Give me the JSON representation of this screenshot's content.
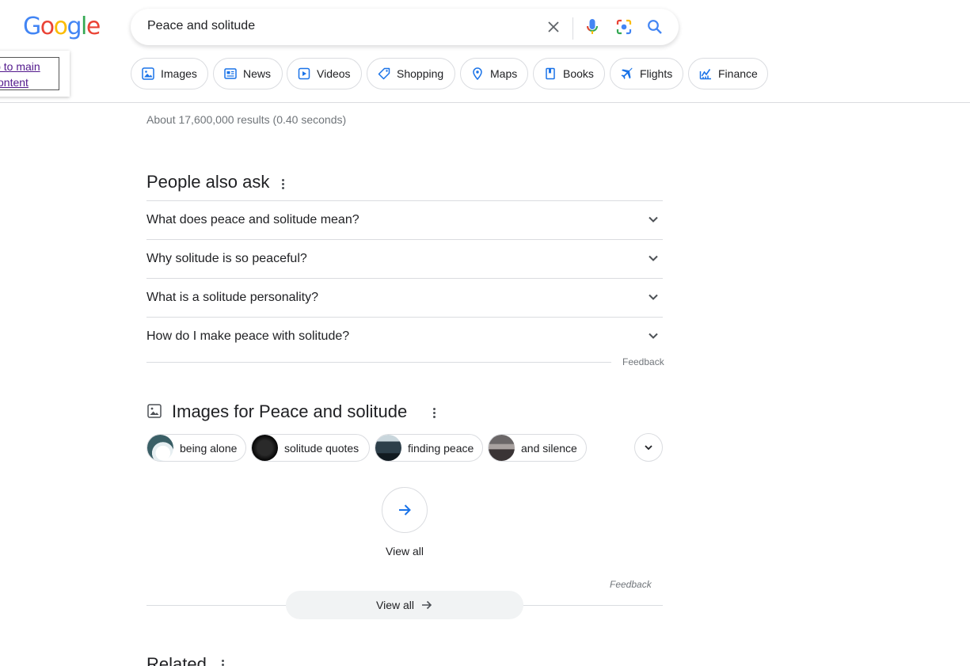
{
  "logo": {
    "letters": [
      "G",
      "o",
      "o",
      "g",
      "l",
      "e"
    ],
    "colors": [
      "#4285F4",
      "#EA4335",
      "#FBBC05",
      "#4285F4",
      "#34A853",
      "#EA4335"
    ]
  },
  "skip_link": {
    "line1": "ip to main",
    "line2": "content"
  },
  "search": {
    "query": "Peace and solitude",
    "icons": [
      "close-icon",
      "microphone-icon",
      "camera-lens-icon",
      "search-icon"
    ]
  },
  "chips": [
    {
      "label": "Images",
      "icon": "image-icon"
    },
    {
      "label": "News",
      "icon": "news-icon"
    },
    {
      "label": "Videos",
      "icon": "video-icon"
    },
    {
      "label": "Shopping",
      "icon": "tag-icon"
    },
    {
      "label": "Maps",
      "icon": "map-pin-icon"
    },
    {
      "label": "Books",
      "icon": "book-icon"
    },
    {
      "label": "Flights",
      "icon": "airplane-icon"
    },
    {
      "label": "Finance",
      "icon": "chart-icon"
    }
  ],
  "result_stats": "About 17,600,000 results (0.40 seconds)",
  "people_also_ask": {
    "title": "People also ask",
    "questions": [
      "What does peace and solitude mean?",
      "Why solitude is so peaceful?",
      "What is a solitude personality?",
      "How do I make peace with solitude?"
    ],
    "feedback": "Feedback"
  },
  "images_section": {
    "title": "Images for Peace and solitude",
    "chips": [
      "being alone",
      "solitude quotes",
      "finding peace",
      "and silence"
    ],
    "view_all": "View all",
    "feedback": "Feedback"
  },
  "view_all_button": "View all",
  "related": {
    "title": "Related"
  },
  "colors": {
    "accent_blue": "#1a73e8",
    "link_visited": "#52188c",
    "divider": "#dadce0"
  }
}
